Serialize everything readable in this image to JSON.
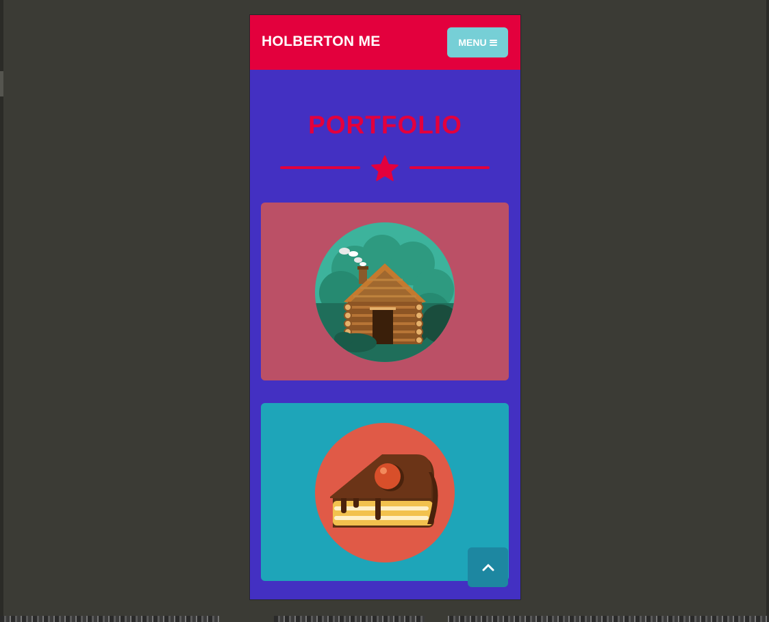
{
  "navbar": {
    "brand": "HOLBERTON ME",
    "menu_label": "MENU",
    "menu_icon": "bars-icon"
  },
  "portfolio": {
    "title": "PORTFOLIO",
    "divider_icon": "star-icon",
    "items": [
      {
        "name": "cabin",
        "icon": "log-cabin-icon",
        "card_color": "#bb5066"
      },
      {
        "name": "cake",
        "icon": "cake-slice-icon",
        "card_color": "#1ea5b9"
      }
    ]
  },
  "scroll_top": {
    "icon": "chevron-up-icon"
  },
  "colors": {
    "accent": "#e3003d",
    "background": "#4330c2",
    "menu_button": "#76cfd6",
    "outer": "#3b3b35"
  }
}
